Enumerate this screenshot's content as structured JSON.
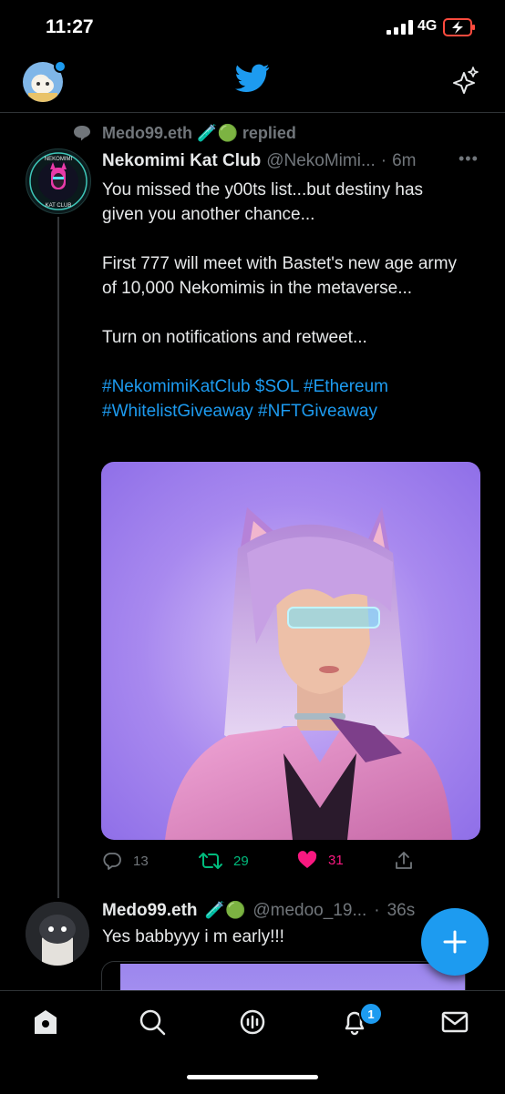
{
  "status_bar": {
    "time": "11:27",
    "network": "4G"
  },
  "header": {
    "logo": "twitter-bird-icon",
    "sparkle": "sparkle-icon"
  },
  "tweet": {
    "context_user": "Medo99.eth",
    "context_emojis": "🧪🟢",
    "context_action": "replied",
    "author_name": "Nekomimi Kat Club",
    "author_handle": "@NekoMimi...",
    "time_sep": "·",
    "time": "6m",
    "avatar_line1": "NEKOMIMI",
    "avatar_line2": "KAT CLUB",
    "text_line1": "You missed the y00ts list...but destiny has given you another chance...",
    "text_line2": "First 777 will meet with Bastet's new age army of 10,000 Nekomimis in the metaverse...",
    "text_line3": "Turn on notifications and retweet...",
    "hashtags_line1": "#NekomimiKatClub $SOL #Ethereum",
    "hashtags_line2": "#WhitelistGiveaway #NFTGiveaway",
    "replies": "13",
    "retweets": "29",
    "likes": "31"
  },
  "reply": {
    "author_name": "Medo99.eth",
    "emojis": "🧪🟢",
    "author_handle": "@medoo_19...",
    "time": "36s",
    "text": "Yes babbyyy i m early!!!"
  },
  "tabbar": {
    "notifications_badge": "1"
  },
  "colors": {
    "accent": "#1d9bf0",
    "like": "#f91880",
    "retweet": "#00ba7c",
    "muted": "#71767b"
  }
}
